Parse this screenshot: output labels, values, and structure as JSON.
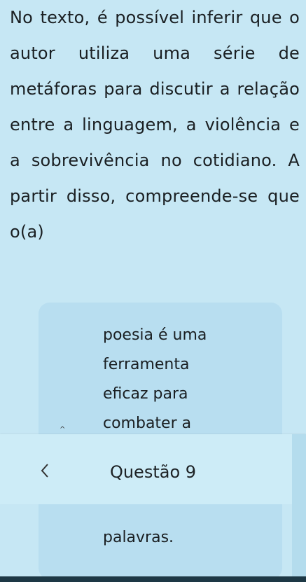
{
  "question": {
    "text": "No texto, é possível inferir que o autor utiliza uma série de metáforas para discutir a relação entre a linguagem, a violência e a sobrevivência no cotidiano. A partir disso, compreende-se que o(a)"
  },
  "option": {
    "lines": [
      "poesia é uma",
      "ferramenta",
      "eficaz para",
      "combater a"
    ],
    "continued": "palavras."
  },
  "navigation": {
    "question_label": "Questão 9",
    "back_icon": "chevron-left-icon"
  },
  "colors": {
    "background": "#c6e7f4",
    "card": "#b8def0",
    "text": "#1a1f22"
  }
}
